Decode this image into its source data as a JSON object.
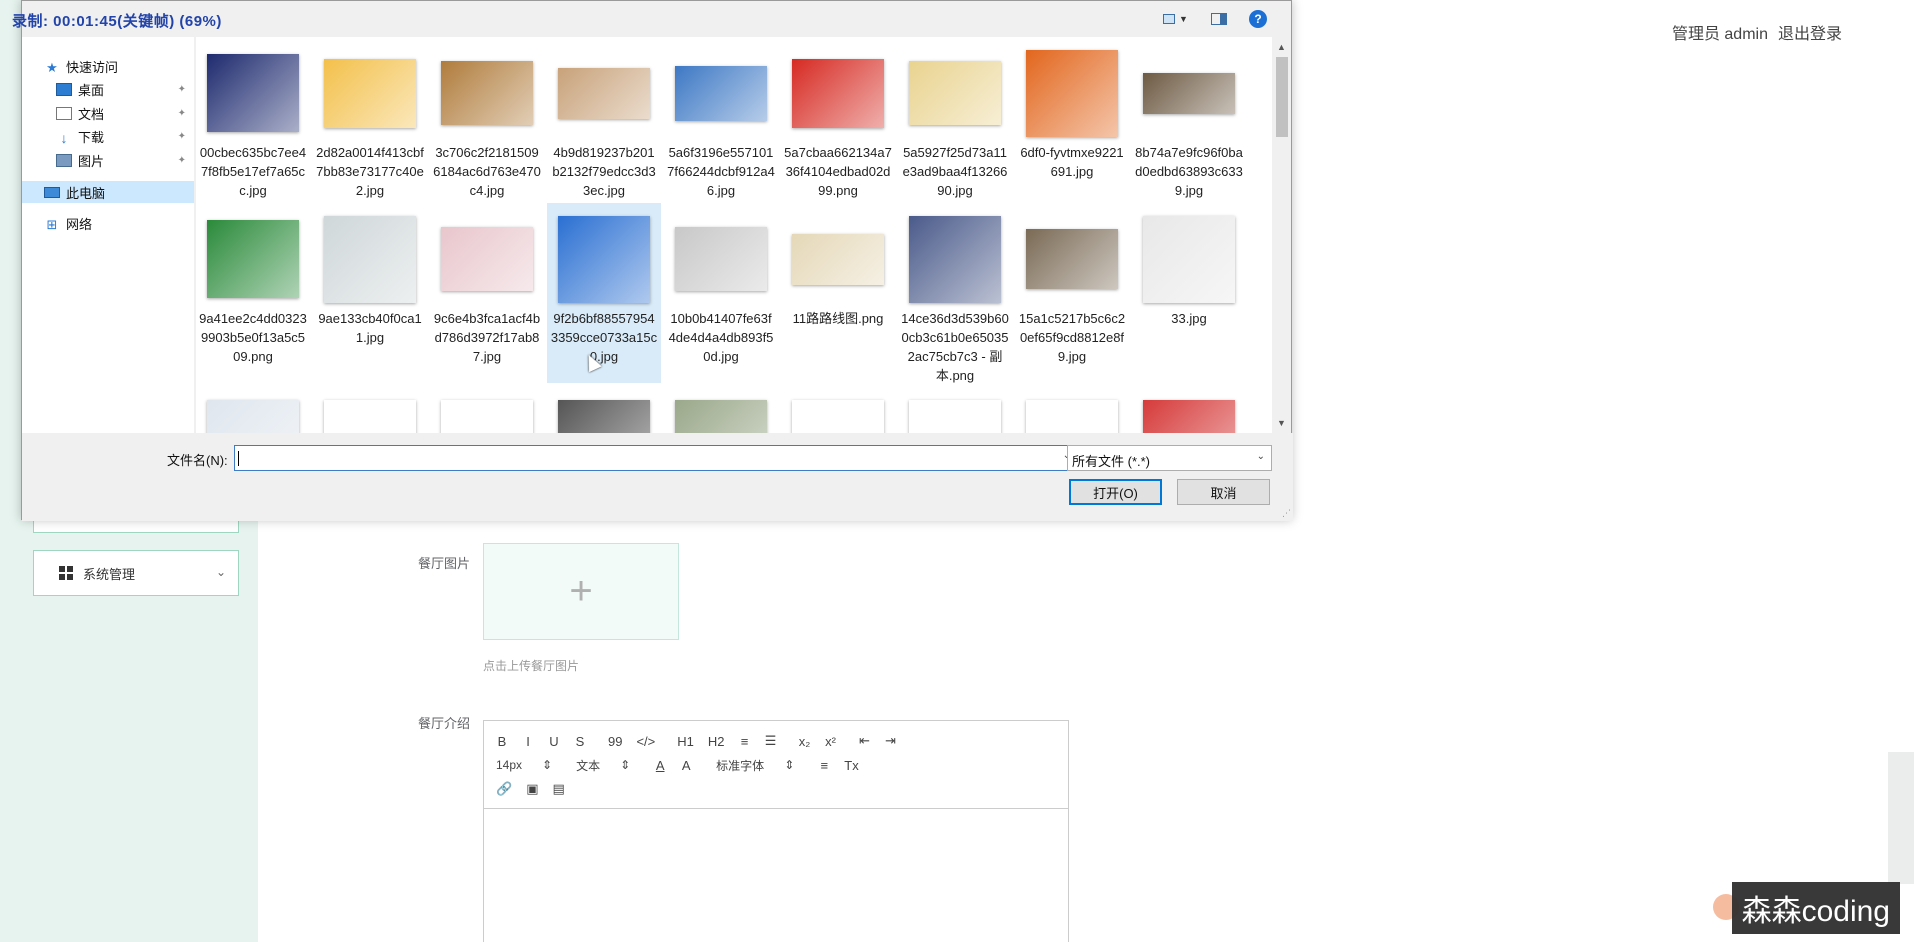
{
  "header": {
    "user": "管理员 admin",
    "logout": "退出登录"
  },
  "sidebar": {
    "system_menu": "系统管理"
  },
  "form": {
    "image_label": "餐厅图片",
    "upload_plus": "+",
    "upload_tip": "点击上传餐厅图片",
    "intro_label": "餐厅介绍"
  },
  "editor": {
    "row1": [
      "B",
      "I",
      "U",
      "S",
      "99",
      "</>",
      "H1",
      "H2",
      "≡",
      "☰",
      "x₂",
      "x²",
      "⇤",
      "⇥"
    ],
    "font_size": "14px",
    "text_style": "文本",
    "font_color": "A",
    "bg_color": "A",
    "font_family": "标准字体",
    "align": "≡",
    "clear_format": "Tx",
    "row3": [
      "🔗",
      "▣",
      "▤"
    ]
  },
  "recording_overlay": "录制: 00:01:45(关键帧) (69%)",
  "watermark": "森森coding",
  "dialog": {
    "nav": {
      "quick_access": "快速访问",
      "desktop": "桌面",
      "documents": "文档",
      "downloads": "下载",
      "pictures": "图片",
      "this_pc": "此电脑",
      "network": "网络"
    },
    "files": [
      {
        "name": "00cbec635bc7ee47f8fb5e17ef7a65cc.jpg",
        "color": "#1d2a6e"
      },
      {
        "name": "2d82a0014f413cbf7bb83e73177c40e2.jpg",
        "color": "#f3c04a"
      },
      {
        "name": "3c706c2f21815096184ac6d763e470c4.jpg",
        "color": "#b07c3c"
      },
      {
        "name": "4b9d819237b201b2132f79edcc3d33ec.jpg",
        "color": "#c8a27a"
      },
      {
        "name": "5a6f3196e5571017f66244dcbf912a46.jpg",
        "color": "#3d78c4"
      },
      {
        "name": "5a7cbaa662134a736f4104edbad02d99.png",
        "color": "#d62a22"
      },
      {
        "name": "5a5927f25d73a11e3ad9baa4f1326690.jpg",
        "color": "#e9d38f"
      },
      {
        "name": "6df0-fyvtmxe9221691.jpg",
        "color": "#e2661d"
      },
      {
        "name": "8b74a7e9fc96f0bad0edbd63893c6339.jpg",
        "color": "#6d5a43"
      },
      {
        "name": "9a41ee2c4dd03239903b5e0f13a5c509.png",
        "color": "#2a8a3a"
      },
      {
        "name": "9ae133cb40f0ca11.jpg",
        "color": "#cfd7d9"
      },
      {
        "name": "9c6e4b3fca1acf4bd786d3972f17ab87.jpg",
        "color": "#e8c6cc"
      },
      {
        "name": "9f2b6bf885579543359cce0733a15c0.jpg",
        "color": "#2a6fd2"
      },
      {
        "name": "10b0b41407fe63f4de4d4a4db893f50d.jpg",
        "color": "#c8c8c8"
      },
      {
        "name": "11路路线图.png",
        "color": "#e5d8b8"
      },
      {
        "name": "14ce36d3d539b600cb3c61b0e650352ac75cb7c3 - 副本.png",
        "color": "#4a5a8a"
      },
      {
        "name": "15a1c5217b5c6c20ef65f9cd8812e8f9.jpg",
        "color": "#7a6a55"
      },
      {
        "name": "33.jpg",
        "color": "#e8e8e8"
      },
      {
        "name": "",
        "color": "#dfe6ee"
      },
      {
        "name": "",
        "color": "#ffffff"
      },
      {
        "name": "",
        "color": "#ffffff"
      },
      {
        "name": "",
        "color": "#555555"
      },
      {
        "name": "",
        "color": "#9aa88a"
      },
      {
        "name": "",
        "color": "#ffffff"
      },
      {
        "name": "",
        "color": "#ffffff"
      },
      {
        "name": "",
        "color": "#ffffff"
      },
      {
        "name": "",
        "color": "#d63a3a"
      }
    ],
    "filename_label": "文件名(N):",
    "filename_value": "",
    "filetype": "所有文件 (*.*)",
    "open": "打开(O)",
    "cancel": "取消"
  }
}
